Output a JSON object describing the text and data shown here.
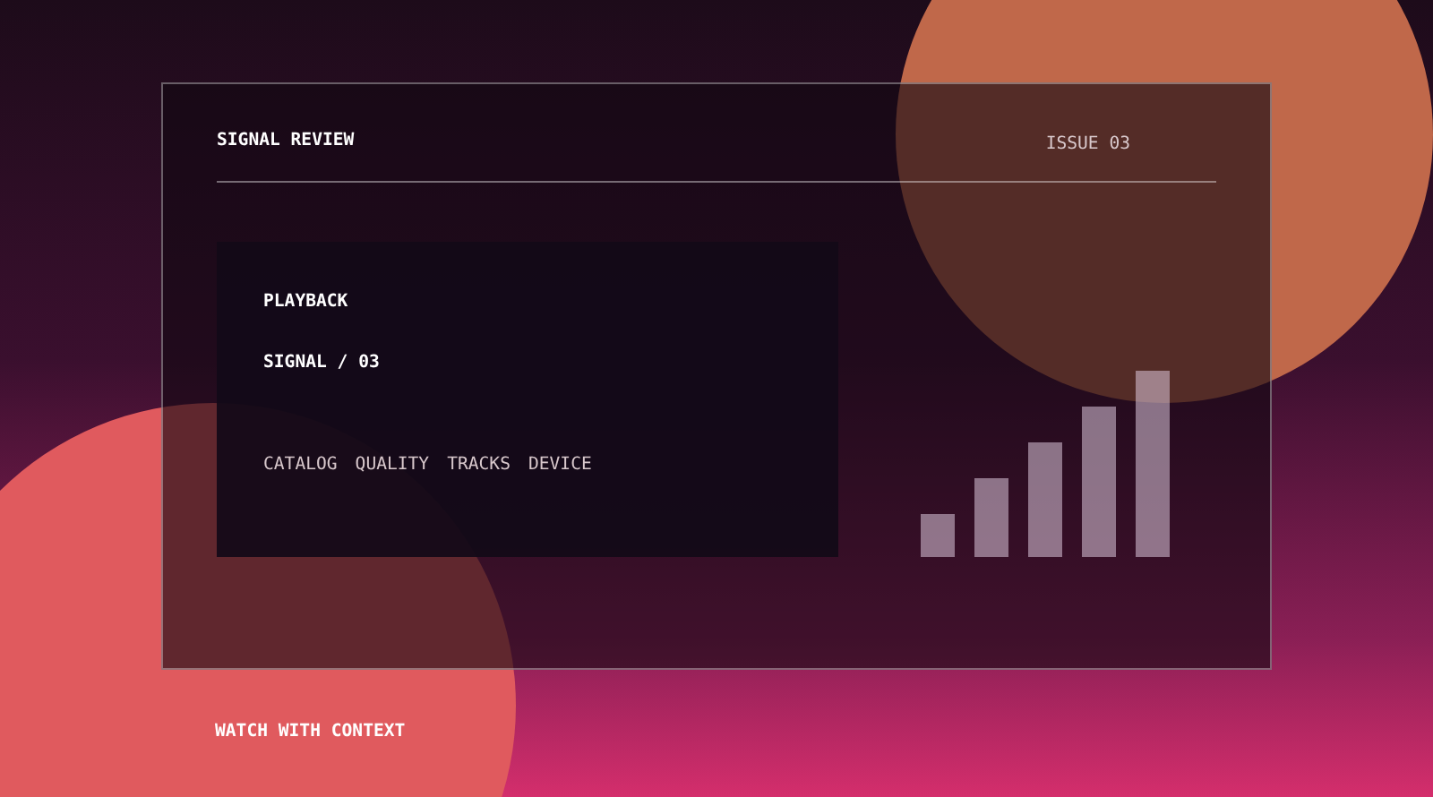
{
  "header": {
    "title": "SIGNAL REVIEW",
    "issue": "ISSUE 03"
  },
  "panel": {
    "label": "PLAYBACK",
    "title": "SIGNAL / 03",
    "tags": [
      "CATALOG",
      "QUALITY",
      "TRACKS",
      "DEVICE"
    ]
  },
  "footer": {
    "caption": "WATCH WITH CONTEXT"
  }
}
